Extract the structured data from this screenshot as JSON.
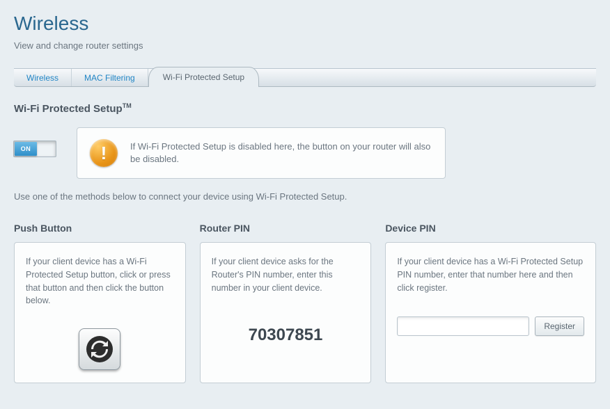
{
  "header": {
    "title": "Wireless",
    "subtitle": "View and change router settings"
  },
  "tabs": [
    {
      "label": "Wireless"
    },
    {
      "label": "MAC Filtering"
    },
    {
      "label": "Wi-Fi Protected Setup"
    }
  ],
  "wps": {
    "section_title_main": "Wi-Fi Protected Setup",
    "section_title_tm": "TM",
    "toggle_label": "ON",
    "alert_text": "If Wi-Fi Protected Setup is disabled here, the button on your router will also be disabled.",
    "helper_text": "Use one of the methods below to connect your device using Wi-Fi Protected Setup."
  },
  "cards": {
    "push": {
      "title": "Push Button",
      "desc": "If your client device has a Wi-Fi Protected Setup button, click or press that button and then click the button below."
    },
    "router_pin": {
      "title": "Router PIN",
      "desc": "If your client device asks for the Router's PIN number, enter this number in your client device.",
      "pin": "70307851"
    },
    "device_pin": {
      "title": "Device PIN",
      "desc": "If your client device has a Wi-Fi Protected Setup PIN number, enter that number here and then click register.",
      "input_value": "",
      "register_label": "Register"
    }
  }
}
